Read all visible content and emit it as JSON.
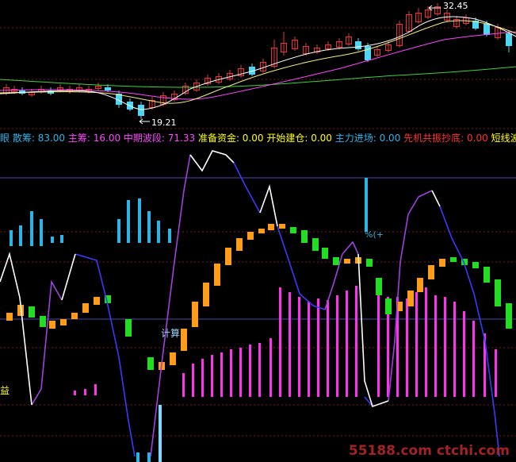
{
  "colors": {
    "background": "#000000",
    "up_candle": "#e8333a",
    "down_candle": "#4fd6f2",
    "ma_white": "#ffffff",
    "ma_yellow": "#f4f07a",
    "ma_magenta": "#ff44ff",
    "ma_green": "#3bd33b",
    "grid_red": "#8a1c1c",
    "grid_blue": "#4a4ab0",
    "orange_bar": "#ff9d1a",
    "green_bar": "#22dd22",
    "cyan_bar": "#2ab4e8",
    "pink_bar": "#ff33ee",
    "blue_line": "#3a3aff",
    "purple_line": "#a040e0",
    "white_line": "#ffffff"
  },
  "price_panel": {
    "high_label": "32.45",
    "low_label": "19.21"
  },
  "indicator_legend": [
    {
      "label": "散筹: 83.00",
      "color": "#2ab4e8"
    },
    {
      "label": "主筹: 16.00",
      "color": "#ff44ff"
    },
    {
      "label": "中期波段: 71.33",
      "color": "#ff44ff"
    },
    {
      "label": "准备资金: 0.00",
      "color": "#ffff00"
    },
    {
      "label": "开始建仓: 0.00",
      "color": "#ffff00"
    },
    {
      "label": "主力进场: 0.00",
      "color": "#2ab4e8"
    },
    {
      "label": "先机共振抄底: 0.00",
      "color": "#ff3333"
    },
    {
      "label": "短线波段:",
      "color": "#ffff00"
    }
  ],
  "legend_left_glyph": "眼",
  "chart_annotations": {
    "calc_label": "计算",
    "percent_label": "%(+",
    "side_label": "益"
  },
  "watermark": "55188.com ctchi.com"
}
